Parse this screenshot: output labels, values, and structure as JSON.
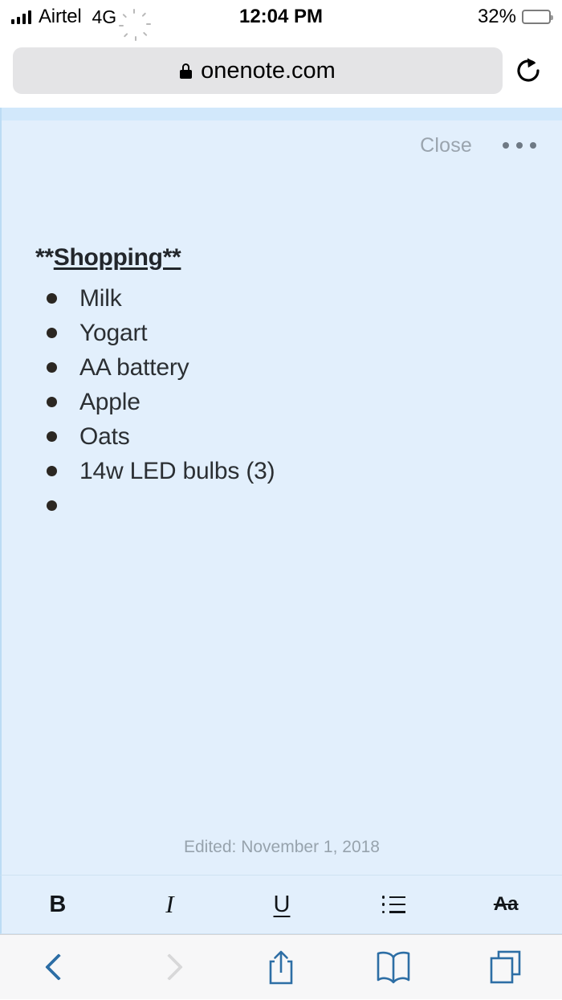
{
  "status_bar": {
    "carrier": "Airtel",
    "network": "4G",
    "time": "12:04 PM",
    "battery_percent": "32%",
    "battery_level_value": 32,
    "signal_bars": 4,
    "icons": [
      "signal-bars-icon",
      "activity-spinner-icon",
      "battery-icon"
    ]
  },
  "browser": {
    "url": "onenote.com",
    "lock_icon": "lock-icon",
    "reload_icon": "reload-icon",
    "toolbar": {
      "back_label": "back-icon",
      "forward_label": "forward-icon",
      "share_label": "share-icon",
      "bookmarks_label": "book-icon",
      "tabs_label": "tabs-icon"
    },
    "colors": {
      "url_field_bg": "#e4e4e6",
      "toolbar_bg": "#f7f7f8",
      "accent": "#2d6ea5",
      "disabled": "#d8d8d9"
    }
  },
  "note": {
    "close_label": "Close",
    "more_label": "•••",
    "title_prefix": "**",
    "title_underlined": "Shopping**",
    "items": [
      {
        "text": "Milk"
      },
      {
        "text": "Yogart"
      },
      {
        "text": "AA battery"
      },
      {
        "text": "Apple"
      },
      {
        "text": "Oats"
      },
      {
        "text": "14w LED bulbs (3)"
      },
      {
        "text": ""
      }
    ],
    "edited": "Edited: November 1, 2018",
    "colors": {
      "page_bg": "#e2effc",
      "top_strip": "#d2e8fb",
      "text": "#2b2f33",
      "muted": "#97a3ad"
    }
  },
  "format_bar": {
    "bold_label": "B",
    "italic_label": "I",
    "underline_label": "U",
    "list_label": "bullet-list-icon",
    "font_label": "Aa"
  }
}
